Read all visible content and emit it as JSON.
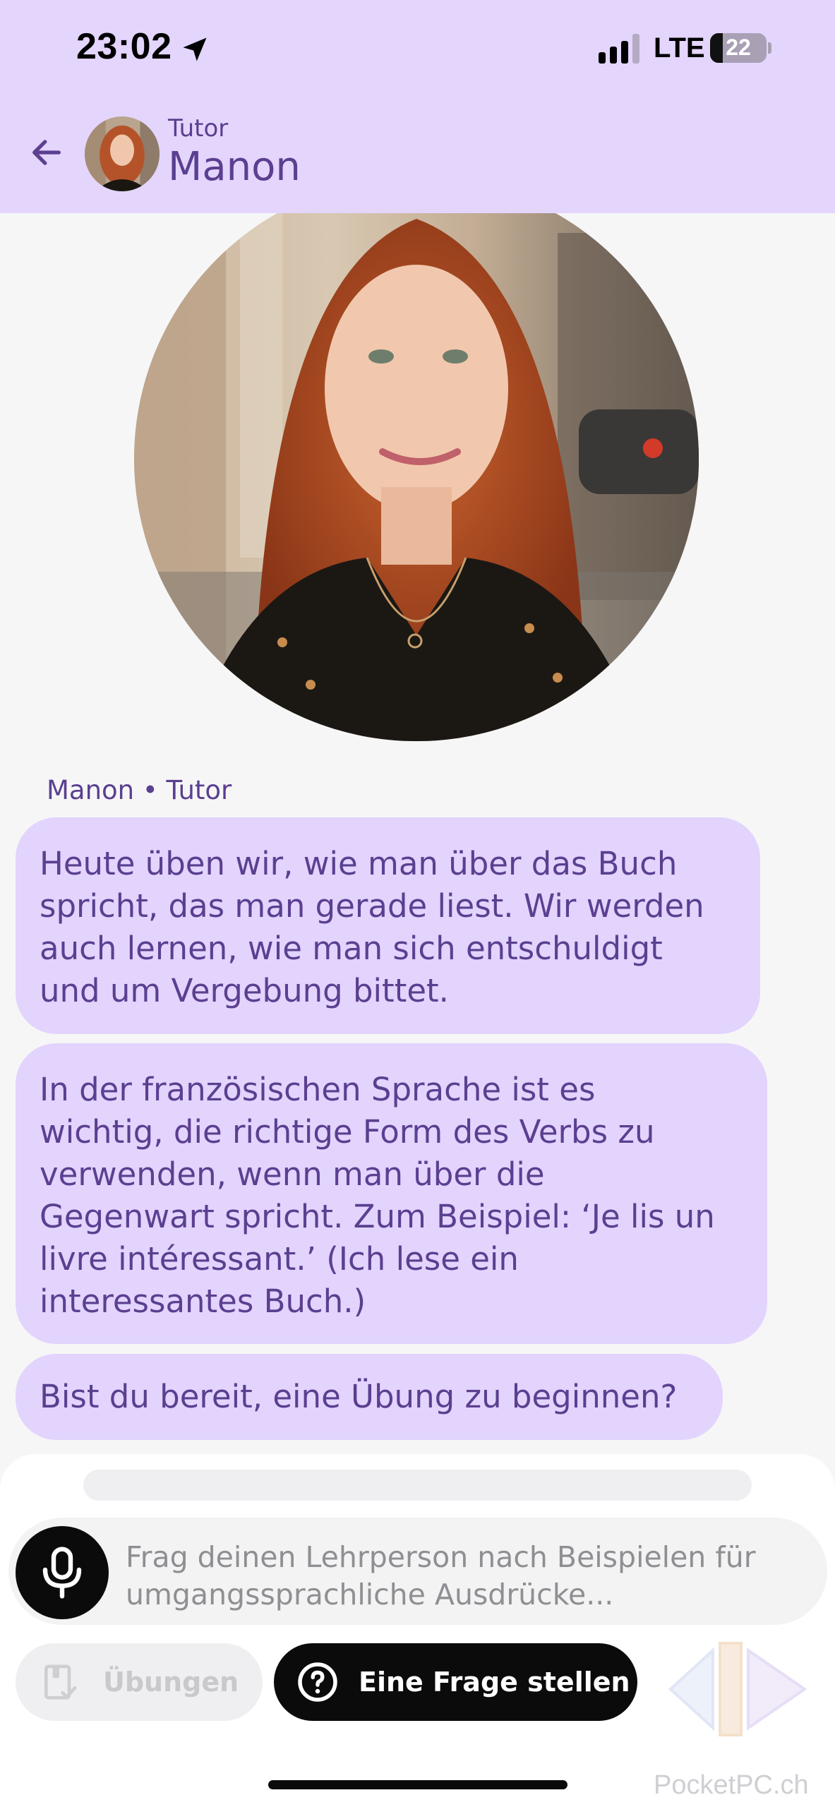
{
  "status_bar": {
    "time": "23:02",
    "network": "LTE",
    "battery": "22",
    "battery_fraction": 0.22
  },
  "header": {
    "role": "Tutor",
    "name": "Manon"
  },
  "chat": {
    "sender_label": "Manon • Tutor",
    "messages": [
      {
        "lines": [
          "Heute üben wir, wie man über das Buch",
          "spricht, das man gerade liest. Wir werden",
          "auch lernen, wie man sich entschuldigt",
          "und um Vergebung bittet."
        ]
      },
      {
        "lines": [
          "In der französischen Sprache ist es",
          "wichtig, die richtige Form des Verbs zu",
          "verwenden, wenn man über die",
          "Gegenwart spricht. Zum Beispiel: ‘Je lis un",
          "livre intéressant.’ (Ich lese ein",
          "interessantes Buch.)"
        ]
      },
      {
        "lines": [
          "Bist du bereit, eine Übung zu beginnen?"
        ]
      }
    ]
  },
  "composer": {
    "placeholder_lines": [
      "Frag deinen Lehrperson nach Beispielen für",
      "umgangssprachliche Ausdrücke..."
    ],
    "practice_label": "Übungen",
    "ask_label": "Eine Frage stellen"
  },
  "watermark": "PocketPC.ch",
  "colors": {
    "header_bg": "#e4d5fd",
    "bubble_bg": "#e2d4fd",
    "accent_text": "#5b3f90",
    "primary_button": "#0b0b0b",
    "disabled_button": "#efeff1",
    "page_bg": "#f6f6f7"
  },
  "icons": {
    "back": "arrow-left-icon",
    "location": "location-arrow-icon",
    "signal": "cellular-signal-icon",
    "battery": "battery-icon",
    "mic": "microphone-icon",
    "practice": "book-check-icon",
    "ask": "question-circle-icon"
  }
}
